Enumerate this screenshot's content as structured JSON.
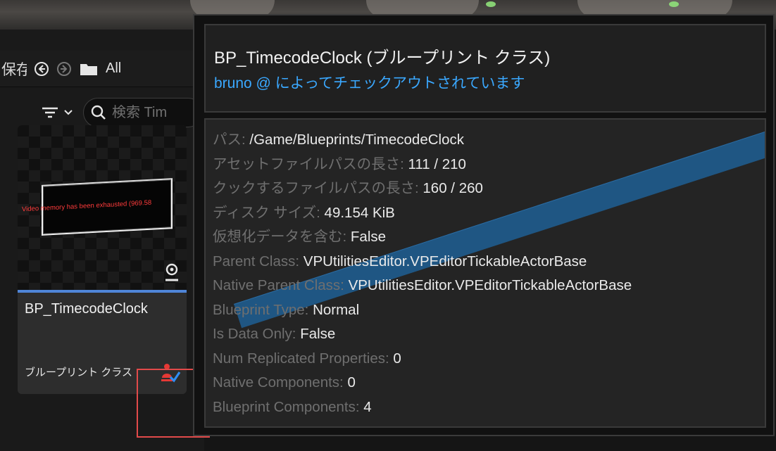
{
  "toolbar": {
    "save_label": "保存",
    "all_label": "All"
  },
  "search": {
    "placeholder": "検索 Tim"
  },
  "asset": {
    "name": "BP_TimecodeClock",
    "type": "ブループリント クラス",
    "thumbnail_message": "Video memory has been exhausted (969.58"
  },
  "tooltip": {
    "title": "BP_TimecodeClock (ブループリント クラス)",
    "checkout": "bruno @  によってチェックアウトされています",
    "properties": [
      {
        "key": "パス:",
        "value": "/Game/Blueprints/TimecodeClock"
      },
      {
        "key": "アセットファイルパスの長さ:",
        "value": "111 / 210"
      },
      {
        "key": "クックするファイルパスの長さ:",
        "value": "160 / 260"
      },
      {
        "key": "ディスク サイズ:",
        "value": "49.154 KiB"
      },
      {
        "key": "仮想化データを含む:",
        "value": "False"
      },
      {
        "key": "Parent Class:",
        "value": "VPUtilitiesEditor.VPEditorTickableActorBase"
      },
      {
        "key": "Native Parent Class:",
        "value": "VPUtilitiesEditor.VPEditorTickableActorBase"
      },
      {
        "key": "Blueprint Type:",
        "value": "Normal"
      },
      {
        "key": "Is Data Only:",
        "value": "False"
      },
      {
        "key": "Num Replicated Properties:",
        "value": "0"
      },
      {
        "key": "Native Components:",
        "value": "0"
      },
      {
        "key": "Blueprint Components:",
        "value": "4"
      }
    ]
  },
  "icons": {
    "back": "back-arrow-icon",
    "forward": "forward-arrow-icon",
    "folder": "folder-icon",
    "filter": "filter-icon",
    "search": "search-icon",
    "actor": "actor-icon",
    "checkout": "checked-out-icon"
  },
  "colors": {
    "checkout_text": "#3aa8ff",
    "highlight": "#e24a4a",
    "thumb_bar": "#4f85d8"
  }
}
